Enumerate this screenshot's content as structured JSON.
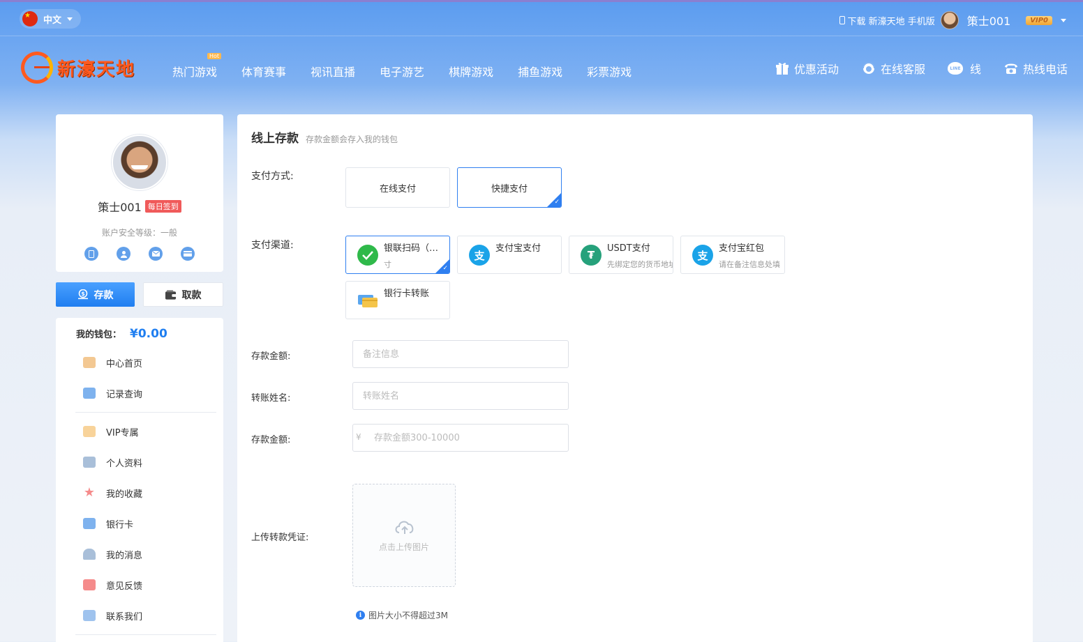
{
  "topbar": {
    "language": "中文",
    "download_text": "下载 新濠天地 手机版",
    "username": "策士001",
    "vip_level": "VIP0"
  },
  "nav": {
    "logo_text": "新濠天地",
    "items": [
      {
        "label": "热门游戏",
        "badge": "Hot"
      },
      {
        "label": "体育赛事"
      },
      {
        "label": "视讯直播"
      },
      {
        "label": "电子游艺"
      },
      {
        "label": "棋牌游戏"
      },
      {
        "label": "捕鱼游戏"
      },
      {
        "label": "彩票游戏"
      }
    ],
    "right": {
      "promo": "优惠活动",
      "service": "在线客服",
      "line": "线",
      "hotline": "热线电话"
    }
  },
  "sidebar": {
    "username": "策士001",
    "signin_badge": "每日签到",
    "security_level": "账户安全等级：一般",
    "deposit_btn": "存款",
    "withdraw_btn": "取款",
    "wallet_label": "我的钱包：",
    "wallet_value": "¥0.00",
    "menu_group1": [
      {
        "label": "中心首页",
        "icon": "home-icon",
        "color": "#f3c892"
      },
      {
        "label": "记录查询",
        "icon": "clipboard-icon",
        "color": "#7eb2ee"
      }
    ],
    "menu_group2": [
      {
        "label": "VIP专属",
        "icon": "diamond-icon",
        "color": "#f8d39a"
      },
      {
        "label": "个人资料",
        "icon": "id-card-icon",
        "color": "#a9bfd9"
      },
      {
        "label": "我的收藏",
        "icon": "star-icon",
        "color": "#f58b8b"
      },
      {
        "label": "银行卡",
        "icon": "bank-card-icon",
        "color": "#7eb2ee"
      },
      {
        "label": "我的消息",
        "icon": "bell-icon",
        "color": "#a9bfd9"
      },
      {
        "label": "意见反馈",
        "icon": "feedback-icon",
        "color": "#f58b8b"
      },
      {
        "label": "联系我们",
        "icon": "chat-icon",
        "color": "#9fc3ee"
      }
    ]
  },
  "main": {
    "title": "线上存款",
    "subtitle": "存款金额会存入我的钱包",
    "pay_method_label": "支付方式:",
    "pay_methods": [
      {
        "label": "在线支付",
        "selected": false
      },
      {
        "label": "快捷支付",
        "selected": true
      }
    ],
    "channel_label": "支付渠道:",
    "channels": [
      {
        "name": "银联扫码（…",
        "desc": "寸",
        "icon": "wechat-icon",
        "color": "#2fb94a",
        "selected": true
      },
      {
        "name": "支付宝支付",
        "desc": "",
        "icon": "alipay-icon",
        "color": "#1aa3e8",
        "selected": false
      },
      {
        "name": "USDT支付",
        "desc": "先绑定您的货币地址",
        "icon": "tether-icon",
        "color": "#26a17b",
        "selected": false
      },
      {
        "name": "支付宝红包",
        "desc": "请在备注信息处填",
        "icon": "alipay-icon",
        "color": "#1aa3e8",
        "selected": false
      },
      {
        "name": "银行卡转账",
        "desc": "",
        "icon": "bank-card-icon",
        "color": "#f5c54a",
        "selected": false
      }
    ],
    "remark_label": "存款金额:",
    "remark_placeholder": "备注信息",
    "name_label": "转账姓名:",
    "name_placeholder": "转账姓名",
    "amount_label": "存款金额:",
    "amount_prefix": "¥",
    "amount_placeholder": "存款金额300-10000",
    "upload_label": "上传转款凭证:",
    "upload_text": "点击上传图片",
    "tip": "图片大小不得超过3M"
  }
}
